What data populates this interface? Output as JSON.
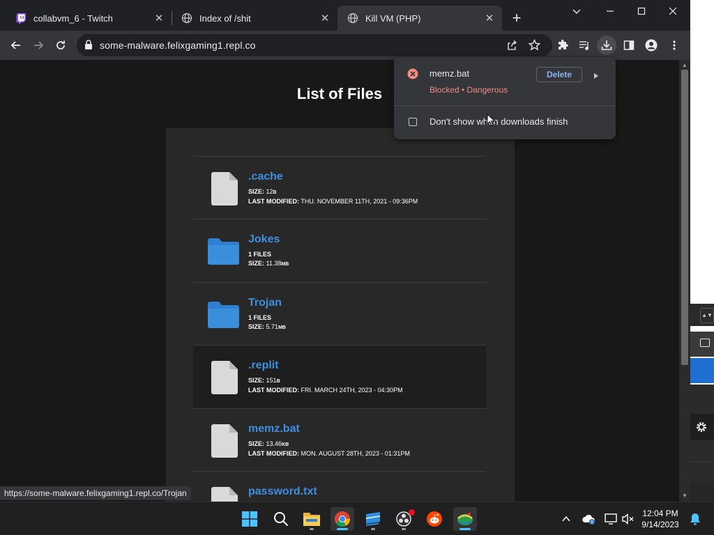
{
  "tabs": [
    {
      "title": "collabvm_6 - Twitch",
      "favicon": "twitch-icon",
      "active": false
    },
    {
      "title": "Index of /shit",
      "favicon": "globe-icon",
      "active": false
    },
    {
      "title": "Kill VM (PHP)",
      "favicon": "globe-icon",
      "active": true
    }
  ],
  "address_bar": {
    "url": "some-malware.felixgaming1.repl.co"
  },
  "page": {
    "title": "List of Files",
    "files": [
      {
        "name": ".cache",
        "type": "file",
        "size_label": "SIZE:",
        "size": "12",
        "size_unit": "B",
        "modified_label": "LAST MODIFIED:",
        "modified": "THU. NOVEMBER 11TH, 2021 - 09:36PM"
      },
      {
        "name": "Jokes",
        "type": "folder",
        "count": "1",
        "count_label": "FILES",
        "size_label": "SIZE:",
        "size": "11.38",
        "size_unit": "MB"
      },
      {
        "name": "Trojan",
        "type": "folder",
        "count": "1",
        "count_label": "FILES",
        "size_label": "SIZE:",
        "size": "5.71",
        "size_unit": "MB"
      },
      {
        "name": ".replit",
        "type": "file",
        "size_label": "SIZE:",
        "size": "151",
        "size_unit": "B",
        "modified_label": "LAST MODIFIED:",
        "modified": "FRI. MARCH 24TH, 2023 - 04:30PM"
      },
      {
        "name": "memz.bat",
        "type": "file",
        "size_label": "SIZE:",
        "size": "13.46",
        "size_unit": "KB",
        "modified_label": "LAST MODIFIED:",
        "modified": "MON. AUGUST 28TH, 2023 - 01:31PM"
      },
      {
        "name": "password.txt",
        "type": "file"
      }
    ]
  },
  "download_bubble": {
    "file_name": "memz.bat",
    "status": "Blocked • Dangerous",
    "delete_label": "Delete",
    "checkbox_label": "Don't show when downloads finish"
  },
  "status_bar": {
    "url": "https://some-malware.felixgaming1.repl.co/Trojan"
  },
  "taskbar": {
    "time": "12:04 PM",
    "date": "9/14/2023"
  },
  "colors": {
    "link": "#3d8fe0",
    "danger": "#f28b82",
    "accent": "#8ab4f8",
    "folder": "#3a8fdc",
    "file": "#d9d9d9"
  }
}
